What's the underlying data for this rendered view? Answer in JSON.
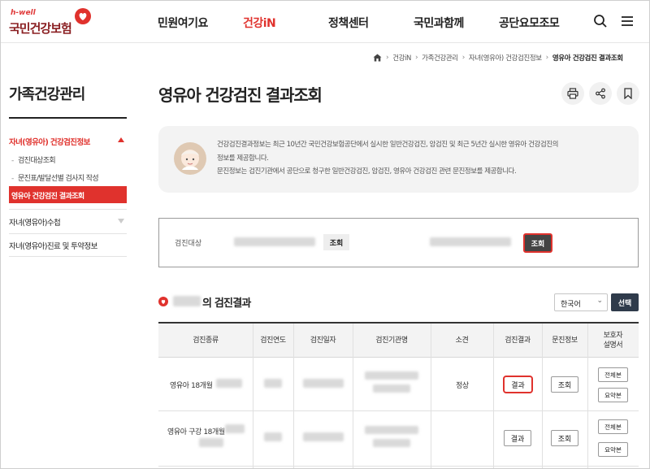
{
  "header": {
    "logo_en": "h-well",
    "logo_ko": "국민건강보험",
    "nav": [
      "민원여기요",
      "건강iN",
      "정책센터",
      "국민과함께",
      "공단요모조모"
    ],
    "nav_active": "건강iN"
  },
  "breadcrumb": [
    "건강iN",
    "가족건강관리",
    "자녀(영유아) 건강검진정보",
    "영유아 건강검진 결과조회"
  ],
  "sidebar": {
    "title": "가족건강관리",
    "section1": "자녀(영유아) 건강검진정보",
    "items": [
      "검진대상조회",
      "문진표/발달선별 검사지 작성",
      "영유아 건강검진 결과조회"
    ],
    "section2": "자녀(영유아)수첩",
    "section3": "자녀(영유아)진료 및 투약정보"
  },
  "page": {
    "title": "영유아 건강검진 결과조회"
  },
  "info": {
    "line1": "건강검진결과정보는 최근 10년간 국민건강보험공단에서 실시한 일반건강검진, 암검진 및 최근 5년간 실시한 영유아 건강검진의",
    "line2": "정보를 제공합니다.",
    "line3": "문진정보는 검진기관에서 공단으로 청구한 일반건강검진, 암검진, 영유아 건강검진 관련 문진정보를 제공합니다."
  },
  "search": {
    "label": "검진대상",
    "btn1": "조회",
    "btn2": "조회"
  },
  "results": {
    "title_suffix": "의 검진결과",
    "language": "한국어",
    "select_btn": "선택",
    "columns": [
      "검진종류",
      "검진연도",
      "검진일자",
      "검진기관명",
      "소견",
      "검진결과",
      "문진정보",
      "보호자\n설명서"
    ],
    "rows": [
      {
        "type": "영유아 18개월",
        "opinion": "정상",
        "result_btn": "결과",
        "survey_btn": "조회",
        "guide_btn1": "전체본",
        "guide_btn2": "요약본"
      },
      {
        "type": "영유아 구강 18개월",
        "opinion": "",
        "result_btn": "결과",
        "survey_btn": "조회",
        "guide_btn1": "전체본",
        "guide_btn2": "요약본"
      }
    ]
  }
}
